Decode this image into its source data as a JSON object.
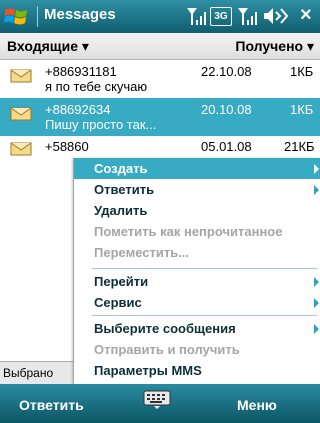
{
  "titlebar": {
    "title": "Messages",
    "network_badge": "3G",
    "icons": [
      "windows-start-icon",
      "signal-icon",
      "signal-icon",
      "volume-icon",
      "close-icon"
    ]
  },
  "header": {
    "folder": "Входящие",
    "sort": "Получено"
  },
  "messages": [
    {
      "sender": "+886931181",
      "date": "22.10.08",
      "size": "1КБ",
      "preview": "я по тебе скучаю",
      "selected": false
    },
    {
      "sender": "+88692634",
      "date": "20.10.08",
      "size": "1КБ",
      "preview": "Пишу просто так...",
      "selected": true
    },
    {
      "sender": "+58860",
      "date": "05.01.08",
      "size": "21КБ",
      "preview": "",
      "selected": false
    }
  ],
  "menu": {
    "items": [
      {
        "label": "Создать",
        "submenu": true,
        "enabled": true,
        "highlighted": true
      },
      {
        "label": "Ответить",
        "submenu": true,
        "enabled": true,
        "highlighted": false
      },
      {
        "label": "Удалить",
        "submenu": false,
        "enabled": true,
        "highlighted": false
      },
      {
        "label": "Пометить как непрочитанное",
        "submenu": false,
        "enabled": false,
        "highlighted": false
      },
      {
        "label": "Переместить...",
        "submenu": false,
        "enabled": false,
        "highlighted": false
      },
      {
        "label": "Перейти",
        "submenu": true,
        "enabled": true,
        "highlighted": false
      },
      {
        "label": "Сервис",
        "submenu": true,
        "enabled": true,
        "highlighted": false
      },
      {
        "label": "Выберите сообщения",
        "submenu": true,
        "enabled": true,
        "highlighted": false
      },
      {
        "label": "Отправить и получить",
        "submenu": false,
        "enabled": false,
        "highlighted": false
      },
      {
        "label": "Параметры MMS",
        "submenu": false,
        "enabled": true,
        "highlighted": false
      }
    ]
  },
  "tab_stub": "Выбрано",
  "softkeys": {
    "left": "Ответить",
    "right": "Меню"
  },
  "colors": {
    "accent": "#37abc3",
    "titlebar": "#1a7385",
    "disabled": "#a5a5a5"
  }
}
